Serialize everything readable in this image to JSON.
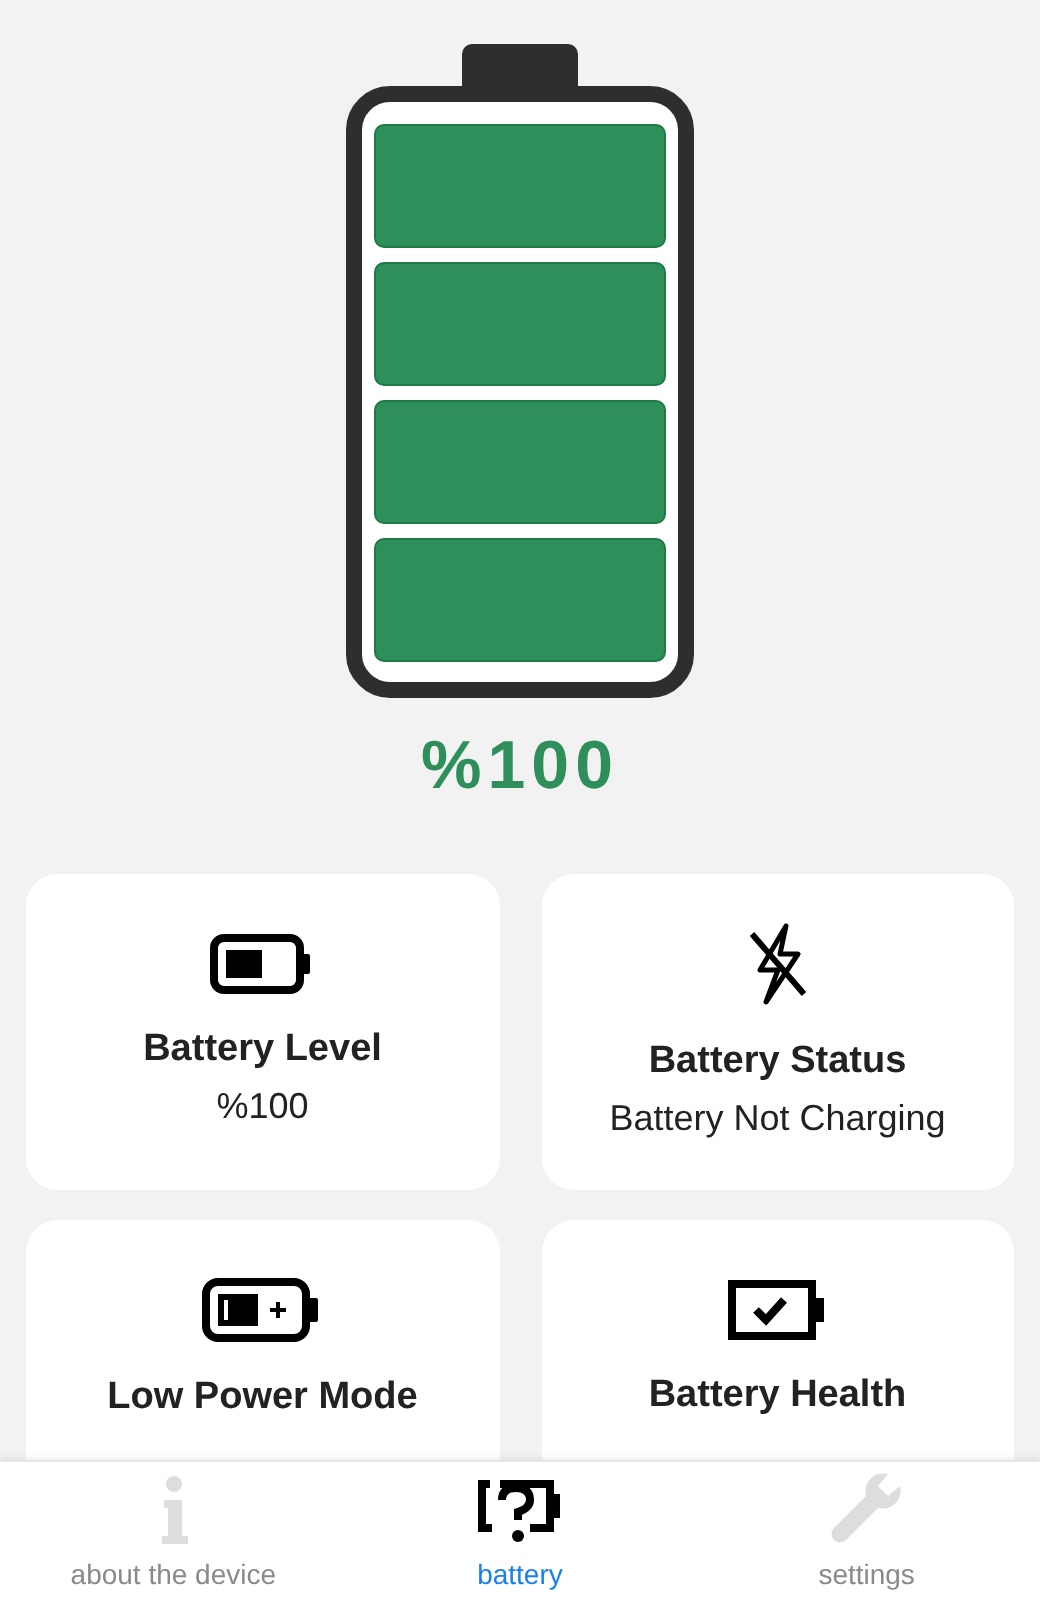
{
  "battery": {
    "segments": [
      {
        "filled": true
      },
      {
        "filled": true
      },
      {
        "filled": true
      },
      {
        "filled": true
      }
    ],
    "percent": "%100"
  },
  "cards": [
    {
      "kind": "level",
      "title": "Battery Level",
      "value": "%100"
    },
    {
      "kind": "status",
      "title": "Battery Status",
      "value": "Battery Not Charging"
    },
    {
      "kind": "lowpower",
      "title": "Low Power Mode"
    },
    {
      "kind": "health",
      "title": "Battery Health"
    }
  ],
  "tabs": [
    {
      "kind": "info",
      "label": "about the device",
      "selected": false
    },
    {
      "kind": "battery",
      "label": "battery",
      "selected": true
    },
    {
      "kind": "settings",
      "label": "settings",
      "selected": false
    }
  ]
}
